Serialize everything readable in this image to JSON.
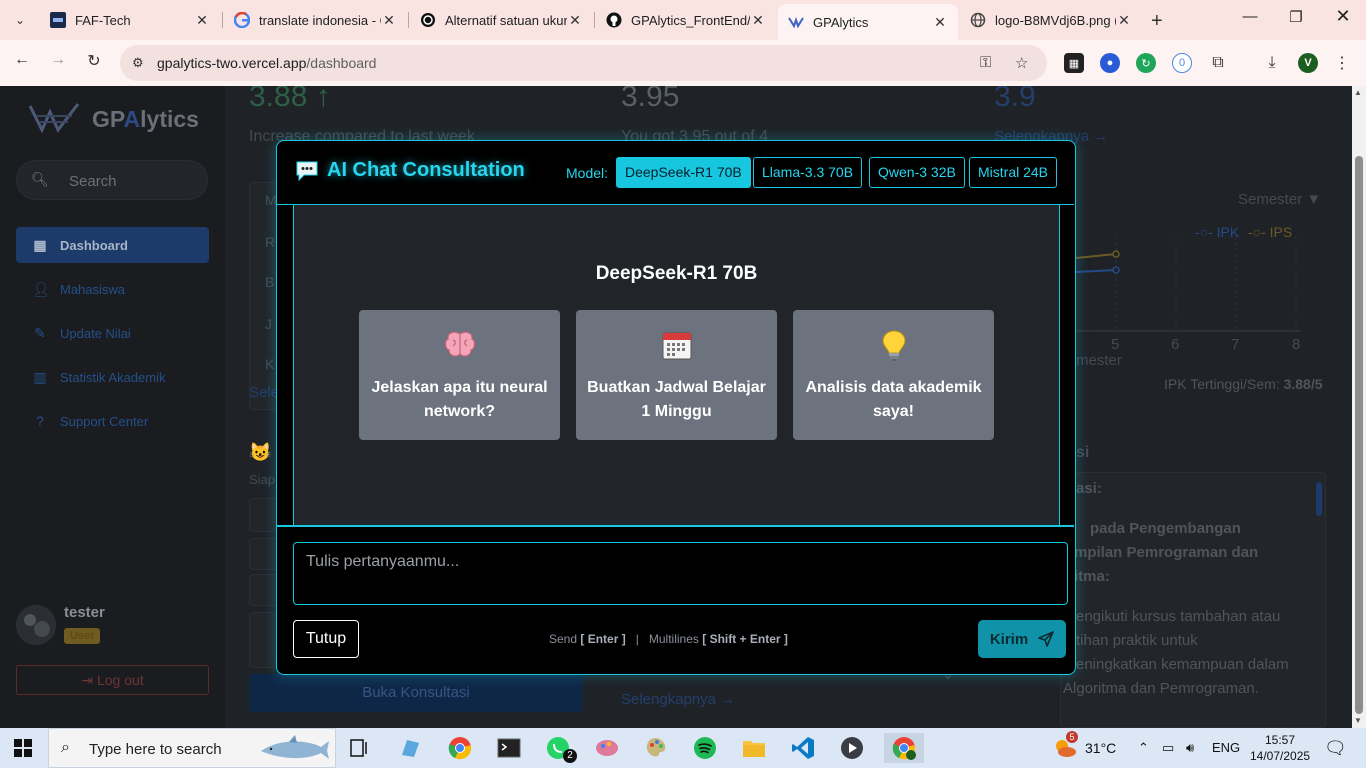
{
  "browser": {
    "tabs": [
      {
        "title": "FAF-Tech",
        "active": false
      },
      {
        "title": "translate indonesia - G",
        "active": false
      },
      {
        "title": "Alternatif satuan ukur",
        "active": false
      },
      {
        "title": "GPAlytics_FrontEnd/P",
        "active": false
      },
      {
        "title": "GPAlytics",
        "active": true
      },
      {
        "title": "logo-B8MVdj6B.png (",
        "active": false
      }
    ],
    "url_host": "gpalytics-two.vercel.app",
    "url_path": "/dashboard",
    "profile_initial": "V"
  },
  "sidebar": {
    "logo_gp": "GP",
    "logo_ai": "A",
    "logo_rest": "lytics",
    "search_placeholder": "Search",
    "items": [
      {
        "label": "Dashboard",
        "icon": "grid-icon"
      },
      {
        "label": "Mahasiswa",
        "icon": "user-icon"
      },
      {
        "label": "Update Nilai",
        "icon": "pencil-icon"
      },
      {
        "label": "Statistik Akademik",
        "icon": "bar-chart-icon"
      },
      {
        "label": "Support Center",
        "icon": "help-icon"
      }
    ],
    "user_name": "tester",
    "user_role": "User",
    "logout_label": "Log out"
  },
  "background": {
    "stat1_value": "3.88 ↑",
    "stat1_caption": "Increase compared to last week",
    "stat2_value": "3.95",
    "stat2_caption": "You got 3.95 out of 4",
    "stat3_value": "3.9",
    "stat3_link": "Selengkapnya →",
    "semester_label": "Semester ▼",
    "legend_ipk": "IPK",
    "legend_ips": "IPS",
    "axis_ticks": [
      "5",
      "6",
      "7",
      "8"
    ],
    "axis_label_partial": "mester",
    "ipk_tertinggi": "IPK Tertinggi/Sem:",
    "ipk_tertinggi_value": "3.88/5",
    "rec_title_partial": "si",
    "rec_sub_partial": "asi:",
    "rec_line1": "pada     Pengembangan",
    "rec_line2": "mpilan  Pemrograman  dan",
    "rec_line3": "itma:",
    "rec_line4": "engikuti kursus tambahan atau",
    "rec_line5": "tihan         praktik         untuk",
    "rec_line6": "eningkatkan kemampuan dalam",
    "rec_line7": "Algoritma dan Pemrograman.",
    "left_list_partial": [
      "M",
      "R",
      "B",
      "J",
      "K"
    ],
    "left_link_partial": "Sele",
    "siap_partial": "Siap",
    "buka_konsultasi": "Buka Konsultasi",
    "selengkapnya_bottom": "Selengkapnya →"
  },
  "modal": {
    "title": "AI Chat Consultation",
    "model_label": "Model:",
    "models": [
      "DeepSeek-R1 70B",
      "Llama-3.3 70B",
      "Qwen-3 32B",
      "Mistral 24B"
    ],
    "selected_model": "DeepSeek-R1 70B",
    "body_title": "DeepSeek-R1 70B",
    "suggestions": [
      {
        "icon": "brain-icon",
        "text": "Jelaskan apa itu neural network?"
      },
      {
        "icon": "calendar-icon",
        "text": "Buatkan Jadwal Belajar 1 Minggu"
      },
      {
        "icon": "lightbulb-icon",
        "text": "Analisis data akademik saya!"
      }
    ],
    "input_placeholder": "Tulis pertanyaanmu...",
    "close_label": "Tutup",
    "hint_send": "Send",
    "hint_send_key": "[ Enter ]",
    "hint_sep": "|",
    "hint_multi": "Multilines",
    "hint_multi_key": "[ Shift + Enter ]",
    "send_label": "Kirim"
  },
  "taskbar": {
    "search_placeholder": "Type here to search",
    "whatsapp_badge": "2",
    "weather_badge": "5",
    "temperature": "31°C",
    "language": "ENG",
    "time": "15:57",
    "date": "14/07/2025"
  },
  "colors": {
    "accent_cyan": "#17c7e0",
    "send_button": "#1093a8",
    "suggestion_card": "#6c737e",
    "tab_bar": "#f9e4e2"
  }
}
